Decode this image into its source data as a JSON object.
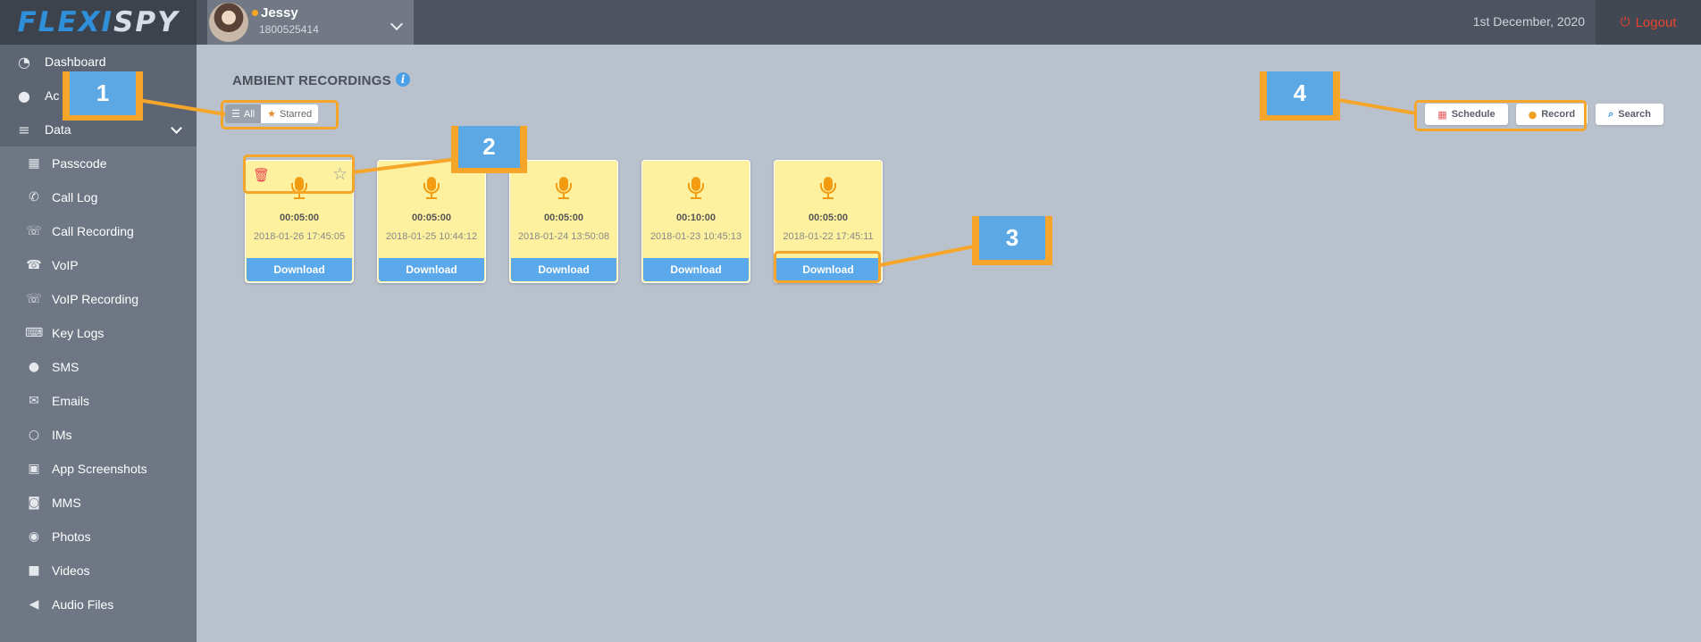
{
  "brand": {
    "part1": "FLEXI",
    "part2": "SPY"
  },
  "device": {
    "name": "Jessy",
    "number": "1800525414"
  },
  "header": {
    "date": "1st December, 2020",
    "logout_label": "Logout"
  },
  "sidebar": {
    "top_items": [
      {
        "label": "Dashboard",
        "icon": "dashboard-icon"
      },
      {
        "label": "Ac",
        "icon": "user-icon"
      },
      {
        "label": "Data",
        "icon": "database-icon"
      }
    ],
    "sub_items": [
      {
        "label": "Passcode",
        "icon": "keypad-icon"
      },
      {
        "label": "Call Log",
        "icon": "phone-icon"
      },
      {
        "label": "Call Recording",
        "icon": "call-recording-icon"
      },
      {
        "label": "VoIP",
        "icon": "voip-icon"
      },
      {
        "label": "VoIP Recording",
        "icon": "voip-recording-icon"
      },
      {
        "label": "Key Logs",
        "icon": "keyboard-icon"
      },
      {
        "label": "SMS",
        "icon": "chat-bubble-icon"
      },
      {
        "label": "Emails",
        "icon": "envelope-icon"
      },
      {
        "label": "IMs",
        "icon": "im-icon"
      },
      {
        "label": "App Screenshots",
        "icon": "screenshots-icon"
      },
      {
        "label": "MMS",
        "icon": "mms-icon"
      },
      {
        "label": "Photos",
        "icon": "camera-icon"
      },
      {
        "label": "Videos",
        "icon": "video-icon"
      },
      {
        "label": "Audio Files",
        "icon": "speaker-icon"
      }
    ]
  },
  "main": {
    "title": "AMBIENT RECORDINGS",
    "filter": {
      "all_label": "All",
      "starred_label": "Starred",
      "active": "All"
    },
    "actions": {
      "schedule_label": "Schedule",
      "record_label": "Record",
      "search_label": "Search"
    },
    "recordings": [
      {
        "duration": "00:05:00",
        "timestamp": "2018-01-26 17:45:05",
        "download_label": "Download"
      },
      {
        "duration": "00:05:00",
        "timestamp": "2018-01-25 10:44:12",
        "download_label": "Download"
      },
      {
        "duration": "00:05:00",
        "timestamp": "2018-01-24 13:50:08",
        "download_label": "Download"
      },
      {
        "duration": "00:10:00",
        "timestamp": "2018-01-23 10:45:13",
        "download_label": "Download"
      },
      {
        "duration": "00:05:00",
        "timestamp": "2018-01-22 17:45:11",
        "download_label": "Download"
      }
    ]
  },
  "annotations": {
    "labels": [
      "1",
      "2",
      "3",
      "4"
    ]
  },
  "colors": {
    "accent_blue": "#5ba8ea",
    "annotation_orange": "#f5a52a",
    "card_yellow": "#fdf1a0",
    "logout_red": "#e8432e"
  }
}
